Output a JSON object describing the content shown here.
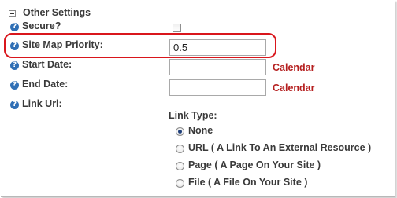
{
  "section": {
    "title": "Other Settings"
  },
  "fields": {
    "secure_label": "Secure?",
    "secure_checked": false,
    "priority_label": "Site Map Priority:",
    "priority_value": "0.5",
    "start_date_label": "Start Date:",
    "start_date_value": "",
    "end_date_label": "End Date:",
    "end_date_value": "",
    "calendar_link": "Calendar",
    "link_url_label": "Link Url:"
  },
  "link_type": {
    "title": "Link Type:",
    "selected": "None",
    "options": [
      {
        "label": "None"
      },
      {
        "label": "URL ( A Link To An External Resource )"
      },
      {
        "label": "Page ( A Page On Your Site )"
      },
      {
        "label": "File ( A File On Your Site )"
      }
    ]
  },
  "colors": {
    "highlight_border": "#d9161c",
    "calendar_link": "#b51f1f",
    "help_icon": "#2f6fb5"
  }
}
